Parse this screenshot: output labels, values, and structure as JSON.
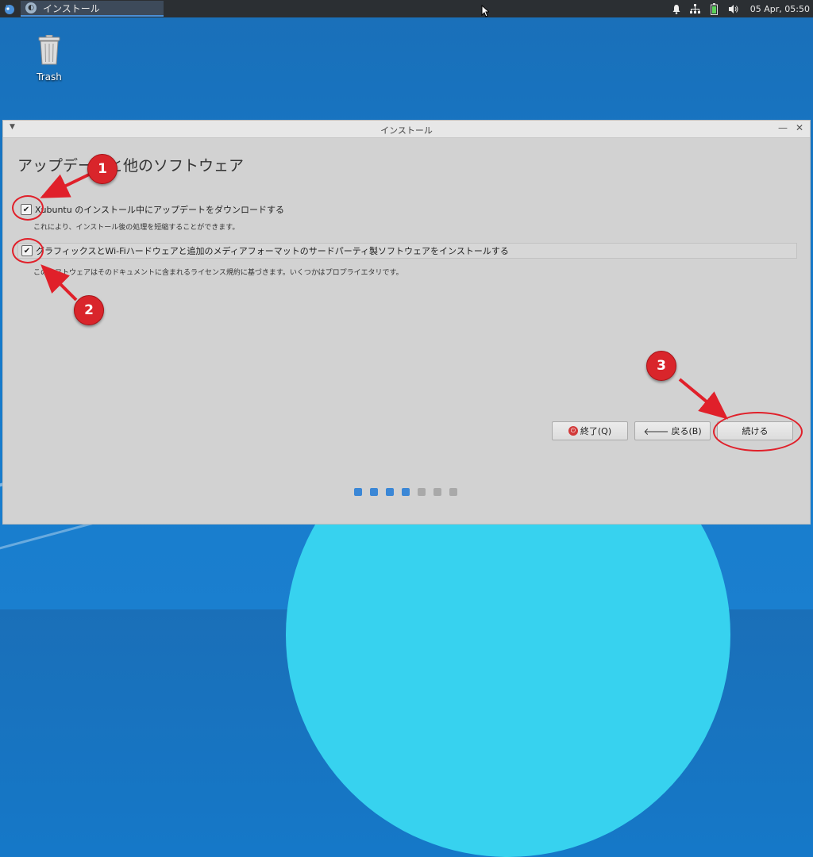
{
  "panel": {
    "task_title": "インストール",
    "clock": "05 Apr, 05:50"
  },
  "desktop": {
    "trash_label": "Trash"
  },
  "window": {
    "title": "インストール",
    "heading": "アップデートと他のソフトウェア",
    "option1": {
      "label": "Xubuntu のインストール中にアップデートをダウンロードする",
      "description": "これにより、インストール後の処理を短縮することができます。",
      "checked": true
    },
    "option2": {
      "label": "グラフィックスとWi-Fiハードウェアと追加のメディアフォーマットのサードパーティ製ソフトウェアをインストールする",
      "description": "このソフトウェアはそのドキュメントに含まれるライセンス規約に基づきます。いくつかはプロプライエタリです。",
      "checked": true
    },
    "buttons": {
      "quit": "終了(Q)",
      "back": "戻る(B)",
      "next": "続ける"
    },
    "progress": {
      "current_step": 4,
      "total_steps": 7
    }
  },
  "annotations": {
    "badge1": "1",
    "badge2": "2",
    "badge3": "3",
    "color": "#d9252b"
  }
}
